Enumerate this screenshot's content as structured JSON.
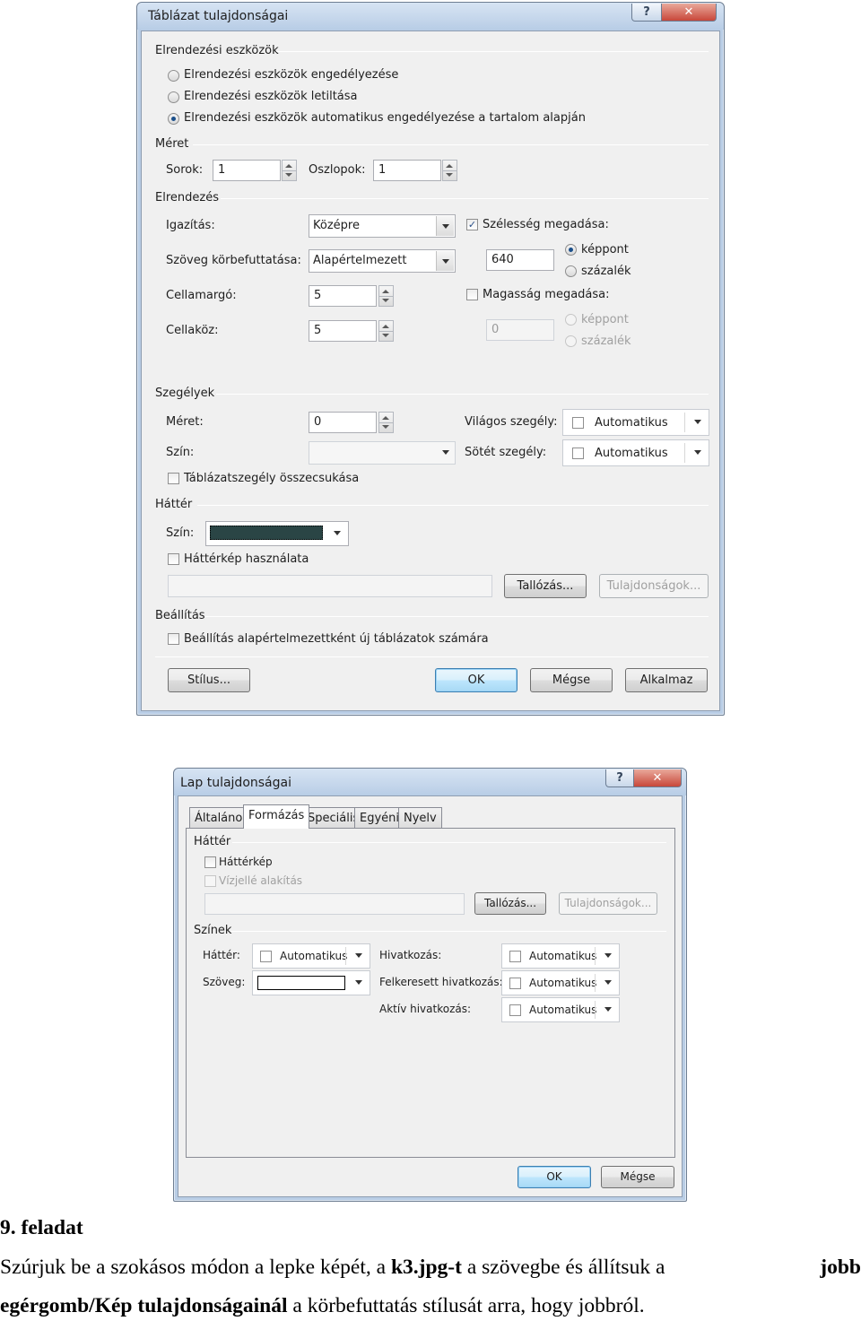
{
  "dialog1": {
    "title": "Táblázat tulajdonságai",
    "help": "?",
    "close": "✕",
    "layout_tools": {
      "title": "Elrendezési eszközök",
      "options": [
        "Elrendezési eszközök engedélyezése",
        "Elrendezési eszközök letiltása",
        "Elrendezési eszközök automatikus engedélyezése a tartalom alapján"
      ],
      "selected": 2
    },
    "size": {
      "title": "Méret",
      "rows_label": "Sorok:",
      "rows_value": "1",
      "cols_label": "Oszlopok:",
      "cols_value": "1"
    },
    "arrangement": {
      "title": "Elrendezés",
      "align_label": "Igazítás:",
      "align_value": "Középre",
      "wrap_label": "Szöveg körbefuttatása:",
      "wrap_value": "Alapértelmezett",
      "padding_label": "Cellamargó:",
      "padding_value": "5",
      "spacing_label": "Cellaköz:",
      "spacing_value": "5",
      "width_label": "Szélesség megadása:",
      "width_checked": "✓",
      "width_value": "640",
      "height_label": "Magasság megadása:",
      "height_value": "0",
      "unit_px": "képpont",
      "unit_pct": "százalék"
    },
    "borders": {
      "title": "Szegélyek",
      "size_label": "Méret:",
      "size_value": "0",
      "color_label": "Szín:",
      "light_label": "Világos szegély:",
      "light_value": "Automatikus",
      "dark_label": "Sötét szegély:",
      "dark_value": "Automatikus",
      "collapse_label": "Táblázatszegély összecsukása"
    },
    "background": {
      "title": "Háttér",
      "color_label": "Szín:",
      "color_value": "#2a4545",
      "use_image_label": "Háttérkép használata",
      "browse": "Tallózás...",
      "properties": "Tulajdonságok..."
    },
    "settings": {
      "title": "Beállítás",
      "default_label": "Beállítás alapértelmezettként új táblázatok számára"
    },
    "buttons": {
      "style": "Stílus...",
      "ok": "OK",
      "cancel": "Mégse",
      "apply": "Alkalmaz"
    }
  },
  "dialog2": {
    "title": "Lap tulajdonságai",
    "help": "?",
    "close": "✕",
    "tabs": [
      "Általános",
      "Formázás",
      "Speciális",
      "Egyéni",
      "Nyelv"
    ],
    "selected_tab": 1,
    "background": {
      "title": "Háttér",
      "image_label": "Háttérkép",
      "watermark_label": "Vízjellé alakítás",
      "browse": "Tallózás...",
      "properties": "Tulajdonságok..."
    },
    "colors": {
      "title": "Színek",
      "bg_label": "Háttér:",
      "bg_value": "Automatikus",
      "text_label": "Szöveg:",
      "link_label": "Hivatkozás:",
      "link_value": "Automatikus",
      "visited_label": "Felkeresett hivatkozás:",
      "visited_value": "Automatikus",
      "active_label": "Aktív hivatkozás:",
      "active_value": "Automatikus"
    },
    "buttons": {
      "ok": "OK",
      "cancel": "Mégse"
    }
  },
  "text": {
    "heading": "9. feladat",
    "p1_a": "Szúrjuk be a szokásos módon a lepke képét, a ",
    "p1_b": "k3.jpg-t",
    "p1_c": " a szövegbe és állítsuk a ",
    "p1_d": "jobb",
    "p2_a": "egérgomb/Kép tulajdonságainál",
    "p2_b": " a körbefuttatás stílusát arra, hogy jobbról."
  }
}
